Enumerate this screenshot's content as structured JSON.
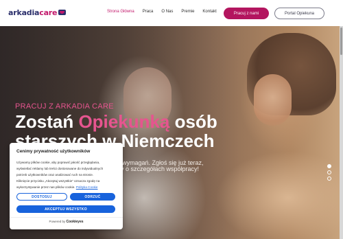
{
  "header": {
    "logo": {
      "part1": "arkadia",
      "part2": "care"
    },
    "nav": [
      {
        "label": "Strona Główna",
        "active": true
      },
      {
        "label": "Praca",
        "active": false
      },
      {
        "label": "O Nas",
        "active": false
      },
      {
        "label": "Premie",
        "active": false
      },
      {
        "label": "Kontakt",
        "active": false
      }
    ],
    "primary_button": "Pracuj z nami",
    "secondary_button": "Portal Opiekuna"
  },
  "hero": {
    "kicker": "PRACUJ Z ARKADIA CARE",
    "headline_part1": "Zostań ",
    "headline_accent": "Opiekunką",
    "headline_part2": " osób starszych w Niemczech",
    "sub_line_1": "wymagań. Zgłoś się już teraz,",
    "sub_line_2": "y o szczegółach współpracy!",
    "slider_dots": 3,
    "active_dot": 0
  },
  "cookie_banner": {
    "title": "Cenimy prywatność użytkowników",
    "body_lines": [
      "Używamy plików cookie, aby poprawić jakość przeglądania,",
      "wyświetlać reklamy lub treści dostosowane do indywidualnych",
      "potrzeb użytkowników oraz analizować ruch na stronie.",
      "Kliknięcie przycisku „Akceptuj wszystkie” oznacza zgodę na",
      "wykorzystywanie przez nas plików cookie."
    ],
    "policy_link": "Polityka Cookie",
    "customize_label": "DOSTOSUJ",
    "reject_label": "ODRZUĆ",
    "accept_label": "AKCEPTUJ WSZYSTKO",
    "powered_prefix": "Powered by",
    "powered_brand": "Cookieyes"
  },
  "colors": {
    "brand_navy": "#2b2f6b",
    "brand_magenta": "#c2186b",
    "accent_pink": "#e6558f",
    "cookie_blue": "#1863dc"
  }
}
